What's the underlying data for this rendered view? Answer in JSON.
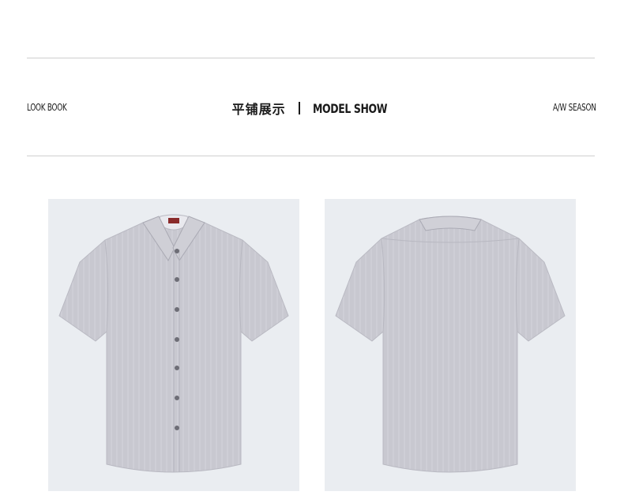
{
  "header": {
    "left_label": "LOOK BOOK",
    "title_cn": "平铺展示",
    "title_en": "MODEL SHOW",
    "right_label": "A/W SEASON"
  },
  "products": [
    {
      "view": "front",
      "color": "#c9c9d0"
    },
    {
      "view": "back",
      "color": "#c9c9d0"
    }
  ]
}
